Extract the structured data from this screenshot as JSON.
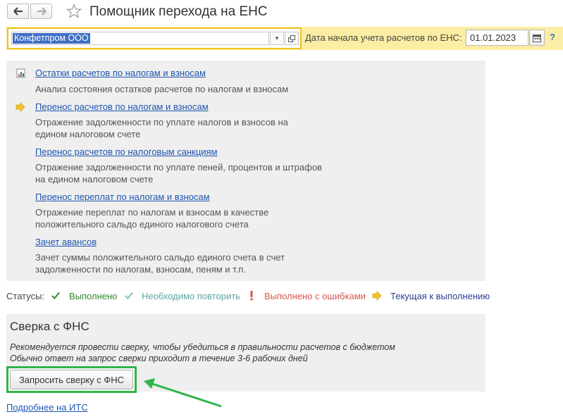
{
  "window": {
    "title": "Помощник перехода на ЕНС"
  },
  "header": {
    "organization": "Конфетпром ООО",
    "date_label": "Дата начала учета расчетов по ЕНС:",
    "date_value": "01.01.2023",
    "help": "?"
  },
  "steps": [
    {
      "link": "Остатки расчетов по налогам и взносам",
      "desc": [
        "Анализ состояния остатков расчетов по налогам и взносам"
      ],
      "icon": "report-icon"
    },
    {
      "link": "Перенос расчетов по налогам и взносам",
      "desc": [
        "Отражение задолженности по уплате налогов и взносов на",
        "едином налоговом счете"
      ],
      "icon": "current-arrow-icon"
    },
    {
      "link": "Перенос расчетов по налоговым санкциям",
      "desc": [
        "Отражение задолженности по уплате пеней, процентов и штрафов",
        "на едином налоговом счете"
      ],
      "icon": ""
    },
    {
      "link": "Перенос переплат по налогам и взносам",
      "desc": [
        "Отражение переплат по налогам и взносам в качестве",
        "положительного сальдо единого налогового счета"
      ],
      "icon": ""
    },
    {
      "link": "Зачет авансов",
      "desc": [
        "Зачет суммы положительного сальдо единого счета в счет",
        "задолженности по налогам, взносам, пеням и т.п."
      ],
      "icon": ""
    }
  ],
  "statuses": {
    "label": "Статусы:",
    "items": [
      {
        "label": "Выполнено",
        "color": "#2e8b2e",
        "icon": "check-icon"
      },
      {
        "label": "Необходимо повторить",
        "color": "#5aa5a0",
        "icon": "check-light-icon"
      },
      {
        "label": "Выполнено с ошибками",
        "color": "#d9534f",
        "icon": "exclamation-icon"
      },
      {
        "label": "Текущая к выполнению",
        "color": "#2a3f8f",
        "icon": "arrow-icon"
      }
    ]
  },
  "reconciliation": {
    "title": "Сверка с ФНС",
    "note1": "Рекомендуется провести сверку, чтобы убедиться в правильности расчетов с бюджетом",
    "note2": "Обычно ответ на запрос сверки приходит в течение 3-6 рабочих дней",
    "button": "Запросить сверку с ФНС"
  },
  "footer": {
    "more_link": "Подробнее на ИТС"
  },
  "colors": {
    "accent_yellow": "#f0c21f",
    "link_blue": "#1d55b0",
    "annotation_green": "#2fb54a"
  }
}
